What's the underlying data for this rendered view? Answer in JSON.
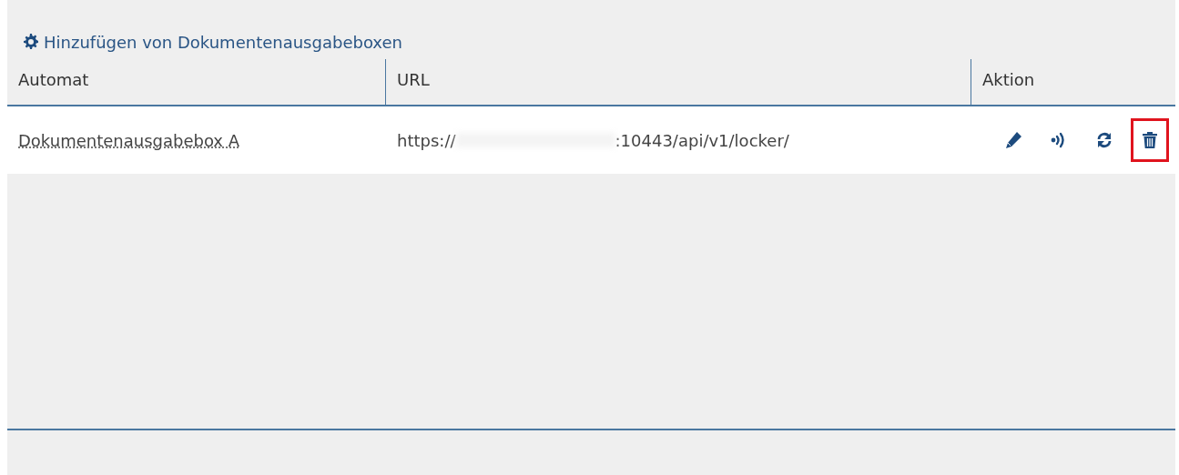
{
  "panel": {
    "title": "Hinzufügen von Dokumentenausgabeboxen"
  },
  "table": {
    "columns": [
      "Automat",
      "URL",
      "Aktion"
    ],
    "rows": [
      {
        "automat": "Dokumentenausgabebox A",
        "url_start": "https://",
        "url_redacted": true,
        "url_end": ":10443/api/v1/locker/",
        "actions": [
          {
            "kind": "edit",
            "highlighted": false
          },
          {
            "kind": "signal",
            "highlighted": false
          },
          {
            "kind": "refresh",
            "highlighted": false
          },
          {
            "kind": "delete",
            "highlighted": true
          }
        ]
      }
    ]
  }
}
